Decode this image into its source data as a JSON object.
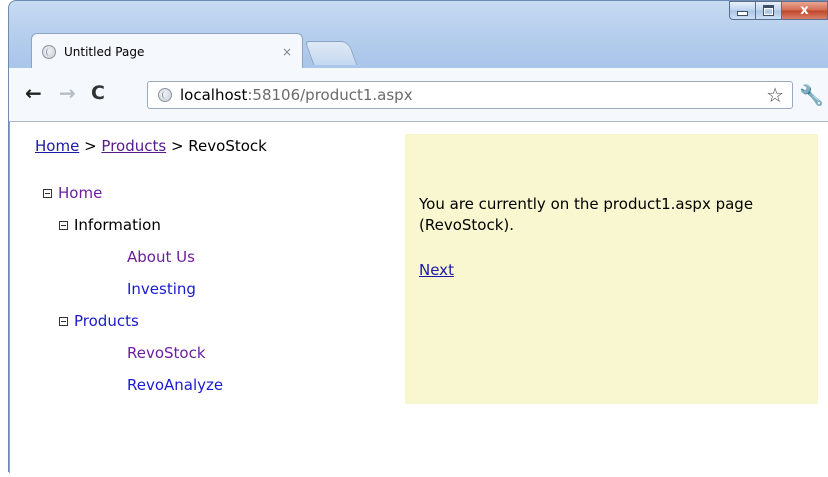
{
  "window": {
    "tab_title": "Untitled Page",
    "tab_close": "×",
    "caption_close": "x"
  },
  "toolbar": {
    "back_icon": "←",
    "forward_icon": "→",
    "reload_icon": "C",
    "url_host": "localhost",
    "url_rest": ":58106/product1.aspx",
    "star_icon": "☆",
    "wrench_icon": "🔧"
  },
  "breadcrumb": {
    "home": "Home",
    "sep1": " > ",
    "products": "Products",
    "sep2": " > ",
    "current": "RevoStock"
  },
  "tree": {
    "home": "Home",
    "information": "Information",
    "about_us": "About Us",
    "investing": "Investing",
    "products": "Products",
    "revostock": "RevoStock",
    "revoanalyze": "RevoAnalyze"
  },
  "panel": {
    "message": "You are currently on the product1.aspx page (RevoStock).",
    "next_link": "Next"
  },
  "colors": {
    "panel_background": "#f9f7cf",
    "visited_link": "#6b1fa0",
    "link": "#1a1ad0"
  }
}
